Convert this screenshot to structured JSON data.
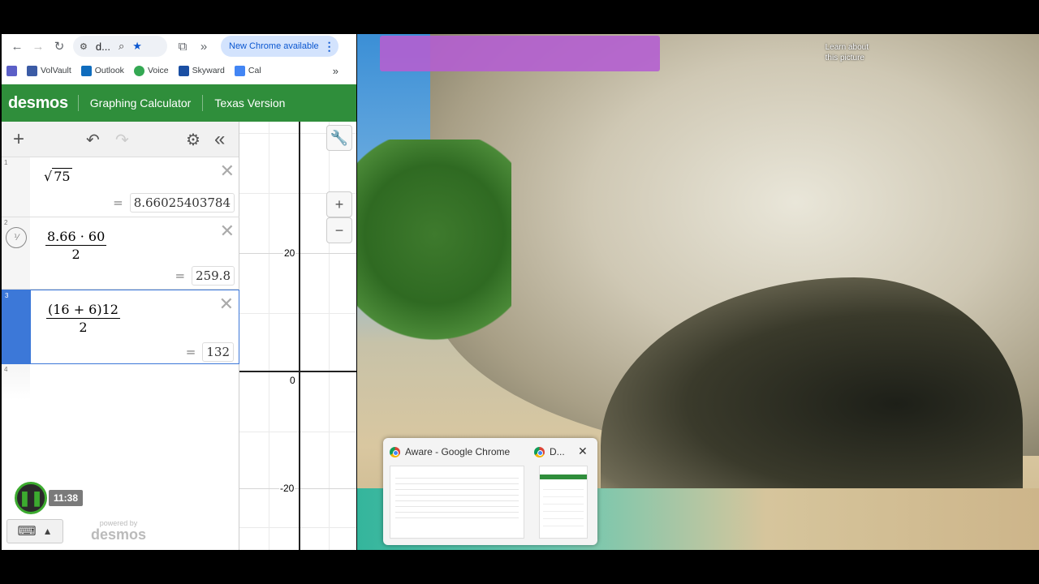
{
  "browser": {
    "omnibox_text": "d...",
    "update_button": "New Chrome available",
    "bookmarks": [
      {
        "label": "VolVault",
        "color": "#3b5ba5"
      },
      {
        "label": "Outlook",
        "color": "#0f6cbd"
      },
      {
        "label": "Voice",
        "color": "#34a853"
      },
      {
        "label": "Skyward",
        "color": "#1a4fa3"
      },
      {
        "label": "Cal",
        "color": "#4285f4"
      }
    ]
  },
  "desmos": {
    "logo": "desmos",
    "nav": [
      "Graphing Calculator",
      "Texas Version"
    ],
    "brand_color": "#2f8e3b",
    "expressions": [
      {
        "num": "1",
        "radicand": "75",
        "result": "8.66025403784"
      },
      {
        "num": "2",
        "numerator": "8.66 · 60",
        "denominator": "2",
        "result": "259.8"
      },
      {
        "num": "3",
        "numerator": "(16 + 6)12",
        "denominator": "2",
        "result": "132"
      },
      {
        "num": "4"
      }
    ],
    "eq_sign": "=",
    "graph": {
      "y_labels": [
        "20",
        "0",
        "-20"
      ]
    },
    "powered_by": "powered by",
    "powered_logo": "desmos"
  },
  "recorder": {
    "time": "11:38"
  },
  "desktop": {
    "learn_line1": "Learn about",
    "learn_line2": "this picture"
  },
  "taskbar_preview": {
    "window1_title": "Aware - Google Chrome",
    "window2_title": "D..."
  }
}
